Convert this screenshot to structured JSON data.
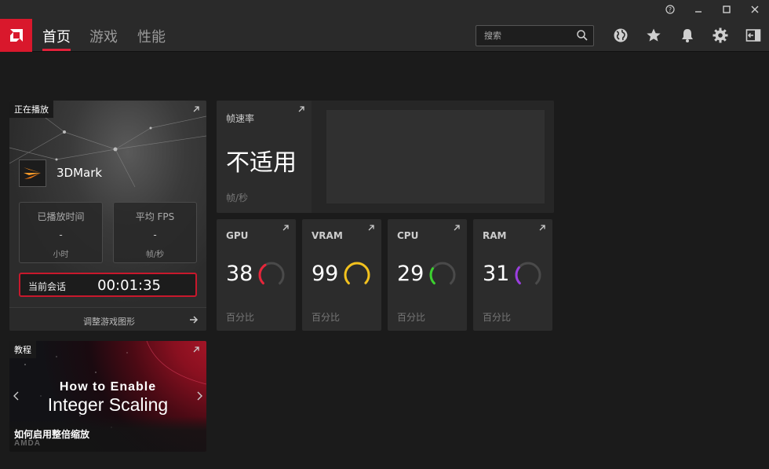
{
  "window": {
    "help_icon": "help-circle-icon",
    "minimize_icon": "minimize-icon",
    "maximize_icon": "maximize-icon",
    "close_icon": "close-icon"
  },
  "nav": {
    "tabs": [
      {
        "label": "首页",
        "active": true
      },
      {
        "label": "游戏",
        "active": false
      },
      {
        "label": "性能",
        "active": false
      }
    ],
    "search_placeholder": "搜索",
    "icons": [
      "globe-icon",
      "star-icon",
      "bell-icon",
      "gear-icon",
      "sidebar-exit-icon"
    ],
    "accent": "#d9182c"
  },
  "now_playing": {
    "tag": "正在播放",
    "game": "3DMark",
    "played_time": {
      "label": "已播放时间",
      "value": "-",
      "unit": "小时"
    },
    "avg_fps": {
      "label": "平均 FPS",
      "value": "-",
      "unit": "帧/秒"
    },
    "session": {
      "label": "当前会话",
      "time": "00:01:35"
    },
    "footer_link": "调整游戏图形"
  },
  "framerate": {
    "title": "帧速率",
    "value": "不适用",
    "unit": "帧/秒"
  },
  "metrics": [
    {
      "title": "GPU",
      "value": "38",
      "unit": "百分比",
      "percent": 38,
      "color": "#e8253a"
    },
    {
      "title": "VRAM",
      "value": "99",
      "unit": "百分比",
      "percent": 99,
      "color": "#f3c21d"
    },
    {
      "title": "CPU",
      "value": "29",
      "unit": "百分比",
      "percent": 29,
      "color": "#3bd12e"
    },
    {
      "title": "RAM",
      "value": "31",
      "unit": "百分比",
      "percent": 31,
      "color": "#9b3ee0"
    }
  ],
  "tutorial": {
    "tag": "教程",
    "headline_line1": "How to Enable",
    "headline_line2": "Integer Scaling",
    "caption": "如何启用整倍缩放",
    "brand": "AMDA"
  }
}
